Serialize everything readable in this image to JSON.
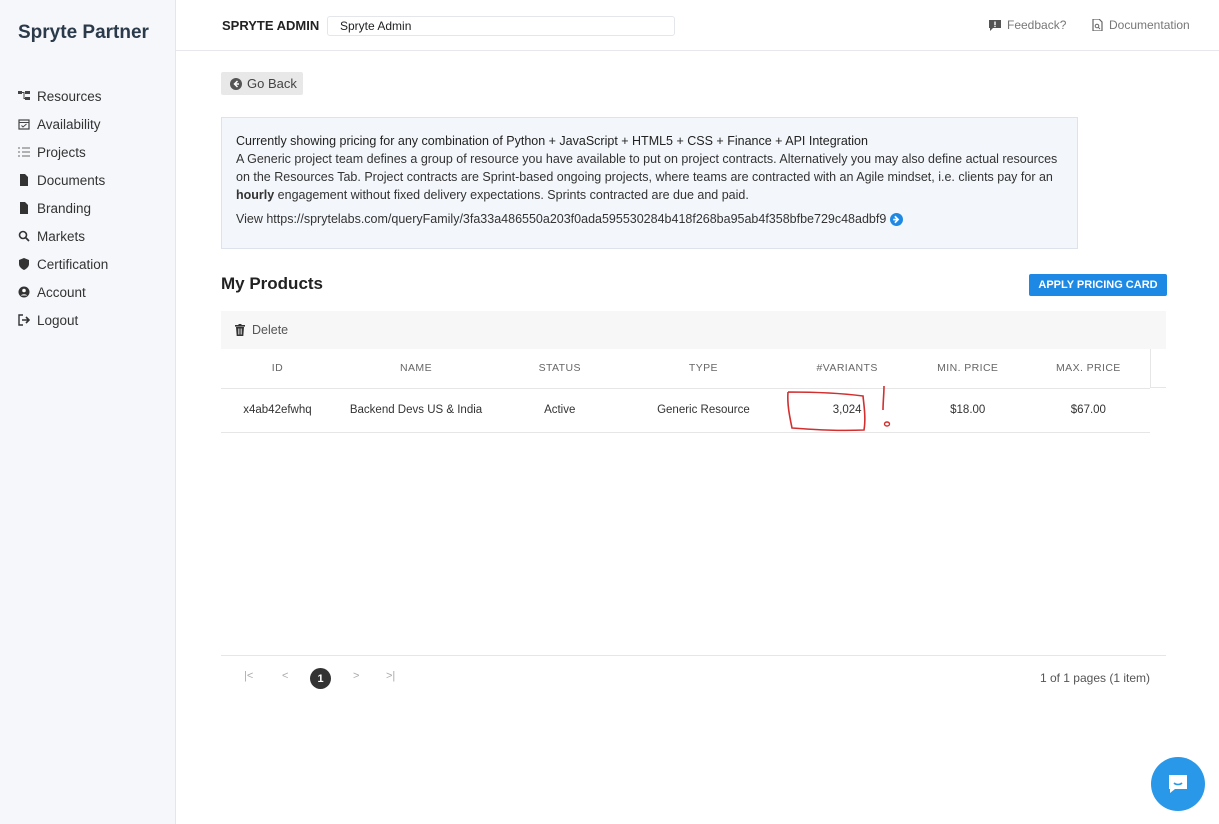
{
  "brand": "Spryte Partner",
  "nav": [
    {
      "label": "Resources",
      "icon": "sitemap-icon"
    },
    {
      "label": "Availability",
      "icon": "calendar-check-icon"
    },
    {
      "label": "Projects",
      "icon": "list-icon"
    },
    {
      "label": "Documents",
      "icon": "file-icon"
    },
    {
      "label": "Branding",
      "icon": "file-icon"
    },
    {
      "label": "Markets",
      "icon": "search-icon"
    },
    {
      "label": "Certification",
      "icon": "shield-icon"
    },
    {
      "label": "Account",
      "icon": "user-circle-icon"
    },
    {
      "label": "Logout",
      "icon": "logout-icon"
    }
  ],
  "topbar": {
    "title": "SPRYTE ADMIN",
    "org_value": "Spryte Admin",
    "feedback": "Feedback?",
    "documentation": "Documentation"
  },
  "go_back": "Go Back",
  "info": {
    "heading": "Currently showing pricing for any combination of Python + JavaScript + HTML5 + CSS + Finance + API Integration",
    "body_1": "A Generic project team defines a group of resource you have available to put on project contracts. Alternatively you may also define actual resources on the Resources Tab. Project contracts are Sprint-based ongoing projects, where teams are contracted with an Agile mindset, i.e. clients pay for an ",
    "body_bold": "hourly",
    "body_2": " engagement without fixed delivery expectations. Sprints contracted are due and paid.",
    "view_link": "View https://sprytelabs.com/queryFamily/3fa33a486550a203f0ada595530284b418f268ba95ab4f358bfbe729c48adbf9"
  },
  "products": {
    "title": "My Products",
    "apply_button": "APPLY PRICING CARD",
    "delete": "Delete",
    "columns": [
      "ID",
      "NAME",
      "STATUS",
      "TYPE",
      "#VARIANTS",
      "MIN. PRICE",
      "MAX. PRICE"
    ],
    "rows": [
      [
        "x4ab42efwhq",
        "Backend Devs US & India",
        "Active",
        "Generic Resource",
        "3,024",
        "$18.00",
        "$67.00"
      ]
    ]
  },
  "pager": {
    "first": "|<",
    "prev": "<",
    "current": "1",
    "next": ">",
    "last": ">|",
    "info": "1 of 1 pages (1 item)"
  },
  "colors": {
    "accent": "#1e88e5",
    "chat": "#2a98e8",
    "annotation": "#d32f2f"
  }
}
